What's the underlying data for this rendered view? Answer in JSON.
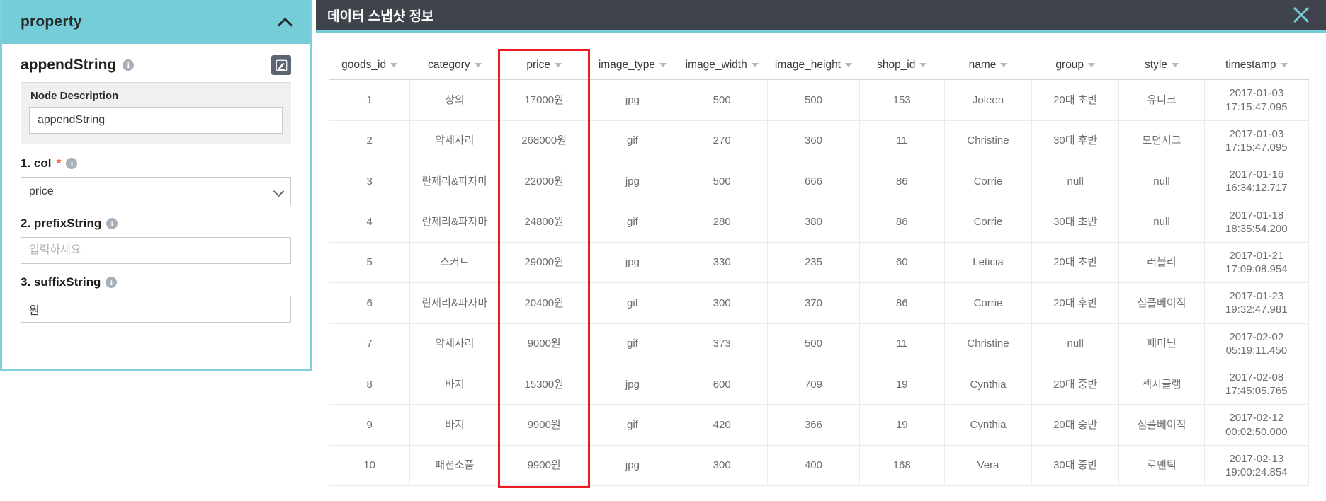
{
  "property_panel": {
    "header_title": "property",
    "collapse_icon": "chevron-up-icon",
    "node_title": "appendString",
    "info_icon": "info-icon",
    "edit_icon": "edit-pencil-icon",
    "node_description_label": "Node Description",
    "node_description_value": "appendString",
    "fields": [
      {
        "label": "1. col",
        "required": true,
        "type": "select",
        "value": "price",
        "options": [
          "goods_id",
          "category",
          "price",
          "image_type",
          "image_width",
          "image_height",
          "shop_id",
          "name",
          "group",
          "style",
          "timestamp"
        ],
        "placeholder": ""
      },
      {
        "label": "2. prefixString",
        "required": false,
        "type": "text",
        "value": "",
        "placeholder": "입력하세요"
      },
      {
        "label": "3. suffixString",
        "required": false,
        "type": "text",
        "value": "원",
        "placeholder": "입력하세요"
      }
    ]
  },
  "snapshot": {
    "header_title": "데이터 스냅샷 정보",
    "close_icon": "close-icon",
    "highlighted_column": "price",
    "columns": [
      {
        "key": "goods_id",
        "label": "goods_id",
        "sortable": true
      },
      {
        "key": "category",
        "label": "category",
        "sortable": true
      },
      {
        "key": "price",
        "label": "price",
        "sortable": true
      },
      {
        "key": "image_type",
        "label": "image_type",
        "sortable": true
      },
      {
        "key": "image_width",
        "label": "image_width",
        "sortable": true
      },
      {
        "key": "image_height",
        "label": "image_height",
        "sortable": true
      },
      {
        "key": "shop_id",
        "label": "shop_id",
        "sortable": true
      },
      {
        "key": "name",
        "label": "name",
        "sortable": true
      },
      {
        "key": "group",
        "label": "group",
        "sortable": true
      },
      {
        "key": "style",
        "label": "style",
        "sortable": true
      },
      {
        "key": "timestamp",
        "label": "timestamp",
        "sortable": true
      }
    ],
    "rows": [
      {
        "goods_id": "1",
        "category": "상의",
        "price": "17000원",
        "image_type": "jpg",
        "image_width": "500",
        "image_height": "500",
        "shop_id": "153",
        "name": "Joleen",
        "group": "20대 초반",
        "style": "유니크",
        "timestamp": "2017-01-03\n17:15:47.095"
      },
      {
        "goods_id": "2",
        "category": "악세사리",
        "price": "268000원",
        "image_type": "gif",
        "image_width": "270",
        "image_height": "360",
        "shop_id": "11",
        "name": "Christine",
        "group": "30대 후반",
        "style": "모던시크",
        "timestamp": "2017-01-03\n17:15:47.095"
      },
      {
        "goods_id": "3",
        "category": "란제리&파자마",
        "price": "22000원",
        "image_type": "jpg",
        "image_width": "500",
        "image_height": "666",
        "shop_id": "86",
        "name": "Corrie",
        "group": "null",
        "style": "null",
        "timestamp": "2017-01-16\n16:34:12.717"
      },
      {
        "goods_id": "4",
        "category": "란제리&파자마",
        "price": "24800원",
        "image_type": "gif",
        "image_width": "280",
        "image_height": "380",
        "shop_id": "86",
        "name": "Corrie",
        "group": "30대 초반",
        "style": "null",
        "timestamp": "2017-01-18\n18:35:54.200"
      },
      {
        "goods_id": "5",
        "category": "스커트",
        "price": "29000원",
        "image_type": "jpg",
        "image_width": "330",
        "image_height": "235",
        "shop_id": "60",
        "name": "Leticia",
        "group": "20대 초반",
        "style": "러블리",
        "timestamp": "2017-01-21\n17:09:08.954"
      },
      {
        "goods_id": "6",
        "category": "란제리&파자마",
        "price": "20400원",
        "image_type": "gif",
        "image_width": "300",
        "image_height": "370",
        "shop_id": "86",
        "name": "Corrie",
        "group": "20대 후반",
        "style": "심플베이직",
        "timestamp": "2017-01-23\n19:32:47.981"
      },
      {
        "goods_id": "7",
        "category": "악세사리",
        "price": "9000원",
        "image_type": "gif",
        "image_width": "373",
        "image_height": "500",
        "shop_id": "11",
        "name": "Christine",
        "group": "null",
        "style": "페미닌",
        "timestamp": "2017-02-02\n05:19:11.450"
      },
      {
        "goods_id": "8",
        "category": "바지",
        "price": "15300원",
        "image_type": "jpg",
        "image_width": "600",
        "image_height": "709",
        "shop_id": "19",
        "name": "Cynthia",
        "group": "20대 중반",
        "style": "섹시글램",
        "timestamp": "2017-02-08\n17:45:05.765"
      },
      {
        "goods_id": "9",
        "category": "바지",
        "price": "9900원",
        "image_type": "gif",
        "image_width": "420",
        "image_height": "366",
        "shop_id": "19",
        "name": "Cynthia",
        "group": "20대 중반",
        "style": "심플베이직",
        "timestamp": "2017-02-12\n00:02:50.000"
      },
      {
        "goods_id": "10",
        "category": "패션소품",
        "price": "9900원",
        "image_type": "jpg",
        "image_width": "300",
        "image_height": "400",
        "shop_id": "168",
        "name": "Vera",
        "group": "30대 중반",
        "style": "로맨틱",
        "timestamp": "2017-02-13\n19:00:24.854"
      }
    ]
  },
  "colors": {
    "accent_teal": "#74cdd8",
    "header_dark": "#3f444c",
    "highlight_red": "#ec1c24",
    "required_orange": "#e8632a"
  }
}
